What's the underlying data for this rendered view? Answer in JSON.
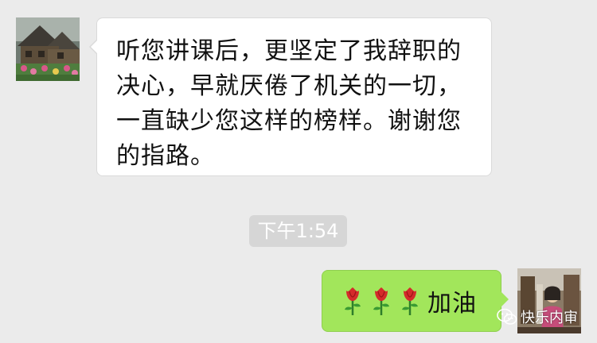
{
  "chat": {
    "messages": [
      {
        "direction": "incoming",
        "text": "听您讲课后，更坚定了我辞职的决心，早就厌倦了机关的一切，一直缺少您这样的榜样。谢谢您的指路。"
      },
      {
        "direction": "outgoing",
        "emoji": [
          "rose-icon",
          "rose-icon",
          "rose-icon"
        ],
        "text": "加油"
      }
    ],
    "timestamp": "下午1:54"
  },
  "watermark": {
    "text": "快乐内审",
    "icon": "wechat-icon"
  },
  "colors": {
    "background": "#ebebeb",
    "incoming_bubble": "#ffffff",
    "outgoing_bubble": "#a2e65b",
    "timestamp_bg": "#d6d6d6"
  }
}
